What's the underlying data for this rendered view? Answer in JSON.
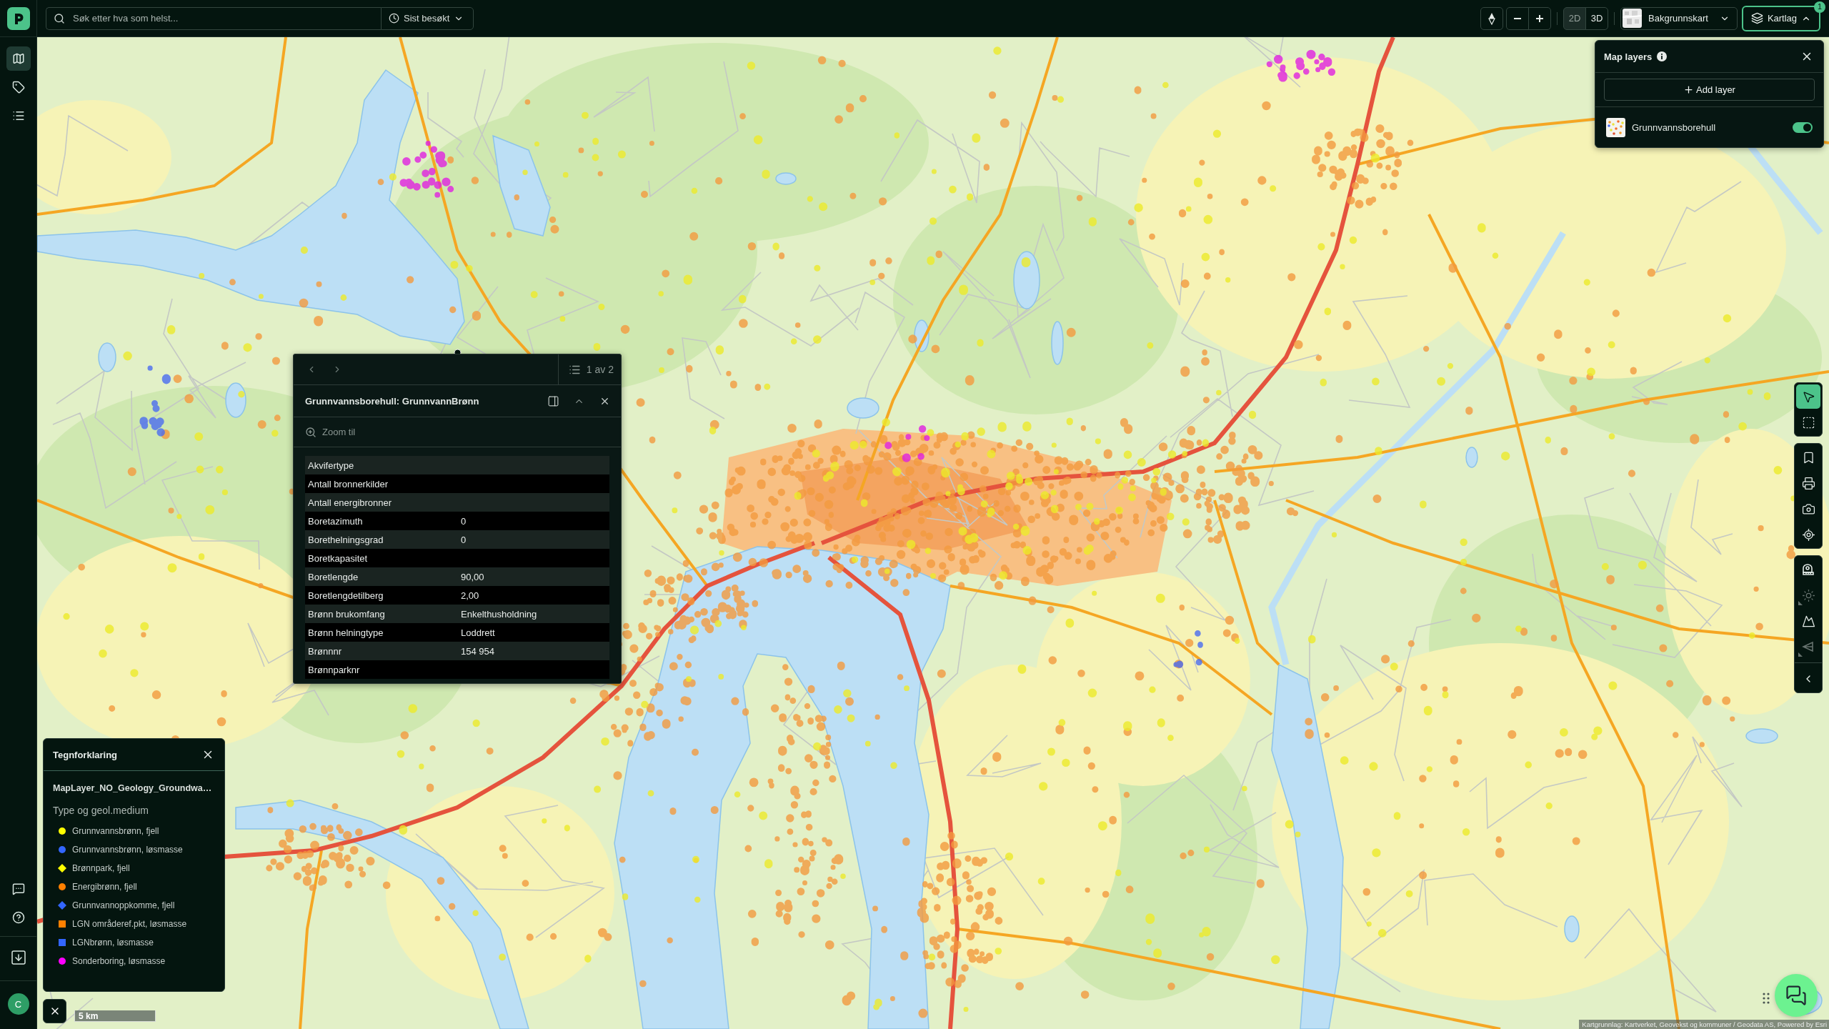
{
  "topbar": {
    "search": {
      "placeholder": "Søk etter hva som helst..."
    },
    "recent_button": {
      "label": "Sist besøkt"
    },
    "view_modes": [
      {
        "label": "2D",
        "selected": true
      },
      {
        "label": "3D",
        "selected": false
      }
    ],
    "basemap_button": {
      "label": "Bakgrunnskart"
    },
    "layers_button": {
      "label": "Kartlag",
      "badge": "1",
      "expanded": true
    }
  },
  "sidebar": {
    "items": [
      {
        "kind": "map",
        "selected": true
      },
      {
        "kind": "tag",
        "selected": false
      },
      {
        "kind": "list",
        "selected": false
      }
    ],
    "avatar": "C"
  },
  "map_layers": {
    "title": "Map layers",
    "add_button": "Add layer",
    "layers": [
      {
        "name": "Grunnvannsborehull",
        "on": true
      }
    ]
  },
  "feature_popup": {
    "pager": "1 av 2",
    "title": "Grunnvannsborehull: GrunnvannBrønn",
    "zoom_link": "Zoom til",
    "attributes": [
      {
        "field": "Akvifertype"
      },
      {
        "field": "Antall bronnerkilder"
      },
      {
        "field": "Antall energibronner"
      },
      {
        "field": "Boretazimuth",
        "value": "0"
      },
      {
        "field": "Borethelningsgrad",
        "value": "0"
      },
      {
        "field": "Boretkapasitet"
      },
      {
        "field": "Boretlengde",
        "value": "90,00"
      },
      {
        "field": "Boretlengdetilberg",
        "value": "2,00"
      },
      {
        "field": "Brønn brukomfang",
        "value": "Enkelthusholdning"
      },
      {
        "field": "Brønn helningtype",
        "value": "Loddrett"
      },
      {
        "field": "Brønnnr",
        "value": "154 954"
      },
      {
        "field": "Brønnparknr"
      }
    ]
  },
  "legend": {
    "title": "Tegnforklaring",
    "layer": "MapLayer_NO_Geology_Groundwa…",
    "group": "Type og geol.medium",
    "items": [
      {
        "label": "Grunnvannsbrønn, fjell",
        "kind": "circle",
        "color": "#ffff00"
      },
      {
        "label": "Grunnvannsbrønn, løsmasse",
        "kind": "circle",
        "color": "#3366ff"
      },
      {
        "label": "Brønnpark, fjell",
        "kind": "diamond",
        "color": "#ffff00"
      },
      {
        "label": "Energibrønn, fjell",
        "kind": "circle",
        "color": "#ff8000"
      },
      {
        "label": "Grunnvannoppkomme, fjell",
        "kind": "diamond",
        "color": "#3366ff"
      },
      {
        "label": "LGN områderef.pkt, løsmasse",
        "kind": "square",
        "color": "#ff8000"
      },
      {
        "label": "LGNbrønn, løsmasse",
        "kind": "square",
        "color": "#3366ff"
      },
      {
        "label": "Sonderboring, løsmasse",
        "kind": "circle",
        "color": "#ff00ff"
      }
    ]
  },
  "map_tools": {
    "groups": [
      {
        "tools": [
          {
            "kind": "pointer",
            "selected": true,
            "disabled": false,
            "submenu": false
          },
          {
            "kind": "area-select",
            "selected": false,
            "disabled": false,
            "submenu": false
          }
        ]
      },
      {
        "tools": [
          {
            "kind": "bookmark",
            "selected": false,
            "disabled": false,
            "submenu": false
          },
          {
            "kind": "print",
            "selected": false,
            "disabled": false,
            "submenu": false
          },
          {
            "kind": "screenshot",
            "selected": false,
            "disabled": false,
            "submenu": false
          },
          {
            "kind": "locate",
            "selected": false,
            "disabled": false,
            "submenu": false
          }
        ]
      },
      {
        "tools": [
          {
            "kind": "measure",
            "selected": false,
            "disabled": false,
            "submenu": false
          },
          {
            "kind": "sun",
            "selected": false,
            "disabled": true,
            "submenu": true
          },
          {
            "kind": "terrain",
            "selected": false,
            "disabled": false,
            "submenu": false
          },
          {
            "kind": "viewshed",
            "selected": false,
            "disabled": true,
            "submenu": true
          }
        ]
      }
    ]
  },
  "scale": "5 km",
  "attribution": "Kartgrunnlag: Kartverket, Geovekst og kommuner / Geodata AS, Powered by Esri"
}
